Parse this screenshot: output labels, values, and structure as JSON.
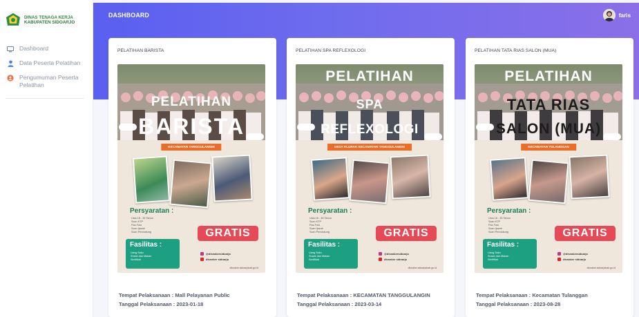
{
  "brand": {
    "line1": "DINAS TENAGA KERJA",
    "line2": "KABUPATEN SIDOARJO"
  },
  "sidebar": {
    "items": [
      {
        "label": "Dashboard",
        "icon": "monitor-icon"
      },
      {
        "label": "Data Peserta Pelatihan",
        "icon": "user-icon"
      },
      {
        "label": "Pengumuman Peserta Pelatihan",
        "icon": "announcement-icon"
      }
    ]
  },
  "header": {
    "title": "DASHBOARD",
    "username": "faris"
  },
  "colors": {
    "accent": "#5a5ff0",
    "brand_green": "#2c7a3b",
    "gratis": "#e74a57",
    "fasilitas": "#1d9f82",
    "banner": "#ec6d2a"
  },
  "cards": [
    {
      "title": "PELATIHAN BARISTA",
      "poster": {
        "heading1": "PELATIHAN",
        "heading2": "BARISTA",
        "banner": "KECAMATAN TANGGULANGIN"
      },
      "tempat": "Tempat Pelaksanaan : Mall Pelayanan Public",
      "tanggal": "Tanggal Pelaksanaan : 2023-01-18"
    },
    {
      "title": "PELATIHAN SPA REFLEXOLOGI",
      "poster": {
        "heading1": "PELATIHAN",
        "heading2": "SPA",
        "heading3": "REFLEXOLOGI",
        "banner": "DESA KLURAK KECAMATAN TANGGULANGIN"
      },
      "tempat": "Tempat Pelaksanaan : KECAMATAN TANGGULANGIN",
      "tanggal": "Tanggal Pelaksanaan : 2023-03-14"
    },
    {
      "title": "PELATIHAN TATA RIAS SALON (MUA)",
      "poster": {
        "heading1": "PELATIHAN",
        "heading2": "TATA RIAS",
        "heading3": "SALON (MUA)",
        "banner": "KECAMATAN TULANGGAN"
      },
      "tempat": "Tempat Pelaksanaan : Kecamatan Tulanggan",
      "tanggal": "Tanggal Pelaksanaan : 2023-08-28"
    }
  ],
  "poster_common": {
    "req_title": "Persyaratan :",
    "req_items": [
      "Usia 18 - 35 Tahun",
      "Scan KTP",
      "Pas Foto",
      "Scan Ijazah",
      "Scan Pendukung"
    ],
    "gratis": "GRATIS",
    "fas_title": "Fasilitas :",
    "fas_items": [
      "Uang Saku",
      "Snack dan Makan",
      "Sertifikat"
    ],
    "social1": "@disnakersidoarjo",
    "social2": "disnaker sidoarjo",
    "url": "disnaker.sidoarjokab.go.id"
  }
}
